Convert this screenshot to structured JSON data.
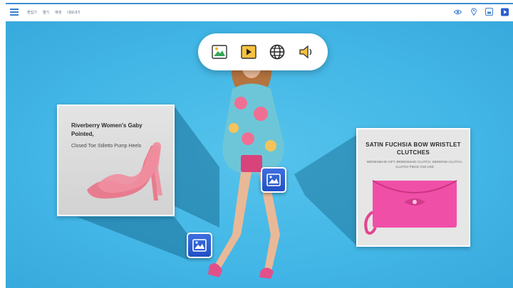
{
  "topbar": {
    "menu_items": [
      "편집기",
      "열기",
      "재생",
      "내보내기"
    ]
  },
  "toolbar": {
    "buttons": [
      "image-icon",
      "play-icon",
      "globe-icon",
      "speaker-icon"
    ]
  },
  "card_left": {
    "title": "Riverberry Women's Gaby Pointed,",
    "subtitle": "Closed Toe Stiletto Pump Heels"
  },
  "card_right": {
    "title": "SATIN FUCHSIA BOW WRISTLET CLUTCHES",
    "subtitle": "BRIDESMAID GIFT, BRIDESMAID CLUTCH, WEDDING CLUTCH, CLUTCH PIECE 3.50 USD"
  },
  "colors": {
    "background": "#42b6e6",
    "accent": "#2a5fd0",
    "shoe": "#e77c8e",
    "clutch": "#f04fa8"
  }
}
